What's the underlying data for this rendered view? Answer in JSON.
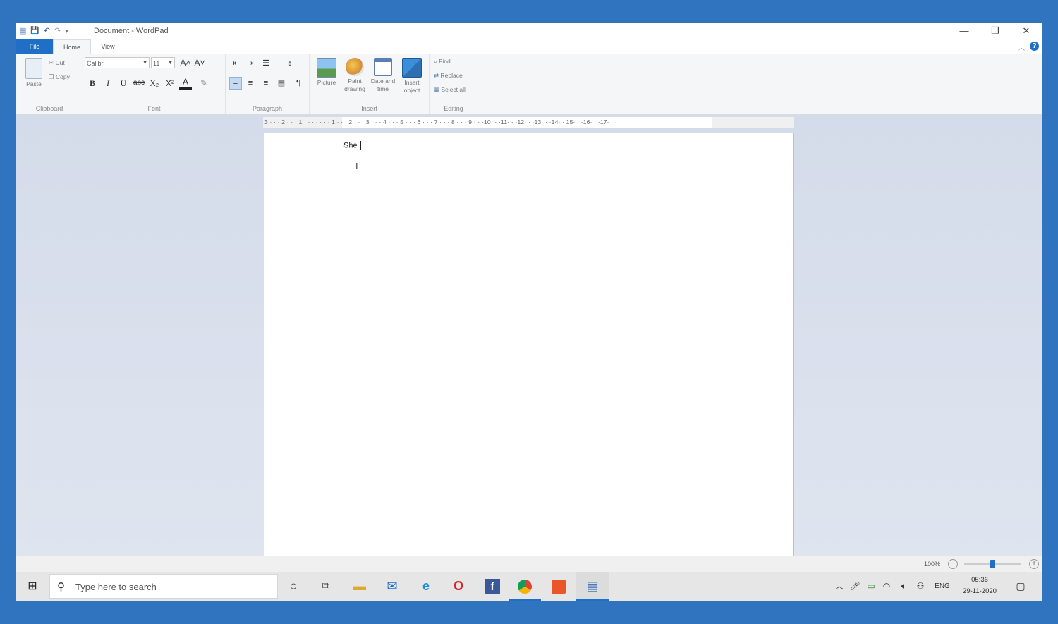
{
  "window": {
    "title": "Document - WordPad",
    "controls": {
      "minimize": "—",
      "restore": "❐",
      "close": "✕"
    }
  },
  "quick_access": {
    "save_icon": "💾",
    "undo_icon": "↶",
    "redo_icon": "↷",
    "customize_icon": "▾"
  },
  "ribbon": {
    "tabs": [
      {
        "label": "File",
        "active": false
      },
      {
        "label": "Home",
        "active": true
      },
      {
        "label": "View",
        "active": false
      }
    ],
    "help_label": "?",
    "clipboard": {
      "label": "Clipboard",
      "paste": "Paste",
      "cut": "Cut",
      "copy": "Copy"
    },
    "font": {
      "label": "Font",
      "family": "Calibri",
      "size": "11",
      "grow": "A˄",
      "shrink": "A˅",
      "bold": "B",
      "italic": "I",
      "underline": "U",
      "strikethrough": "abc",
      "subscript": "X₂",
      "superscript": "X²",
      "text_color": "A",
      "highlight": "✎"
    },
    "paragraph": {
      "label": "Paragraph"
    },
    "insert": {
      "label": "Insert",
      "picture": "Picture",
      "paint_line1": "Paint",
      "paint_line2": "drawing",
      "date_line1": "Date and",
      "date_line2": "time",
      "object_line1": "Insert",
      "object_line2": "object"
    },
    "editing": {
      "label": "Editing",
      "find": "Find",
      "replace": "Replace",
      "select_all": "Select all"
    }
  },
  "ruler": {
    "marks": "3 · · · 2 · · · 1 · · · · · · · 1 · · · 2 · · · 3 · · · 4 · · · 5 · · · 6 · · · 7 · · · 8 · · · 9 · · ·10· · ·11· · ·12· · ·13· · ·14· · 15· · ·16· · ·17· · ·"
  },
  "document": {
    "text": "She"
  },
  "status": {
    "zoom": "100%",
    "zoom_minus": "−",
    "zoom_plus": "+",
    "zoom_level": 0.5
  },
  "taskbar": {
    "search_placeholder": "Type here to search",
    "clock_time": "05:36",
    "clock_date": "29-11-2020",
    "language": "ENG"
  },
  "colors": {
    "accent": "#1f6fc6",
    "frame": "#3073be"
  }
}
